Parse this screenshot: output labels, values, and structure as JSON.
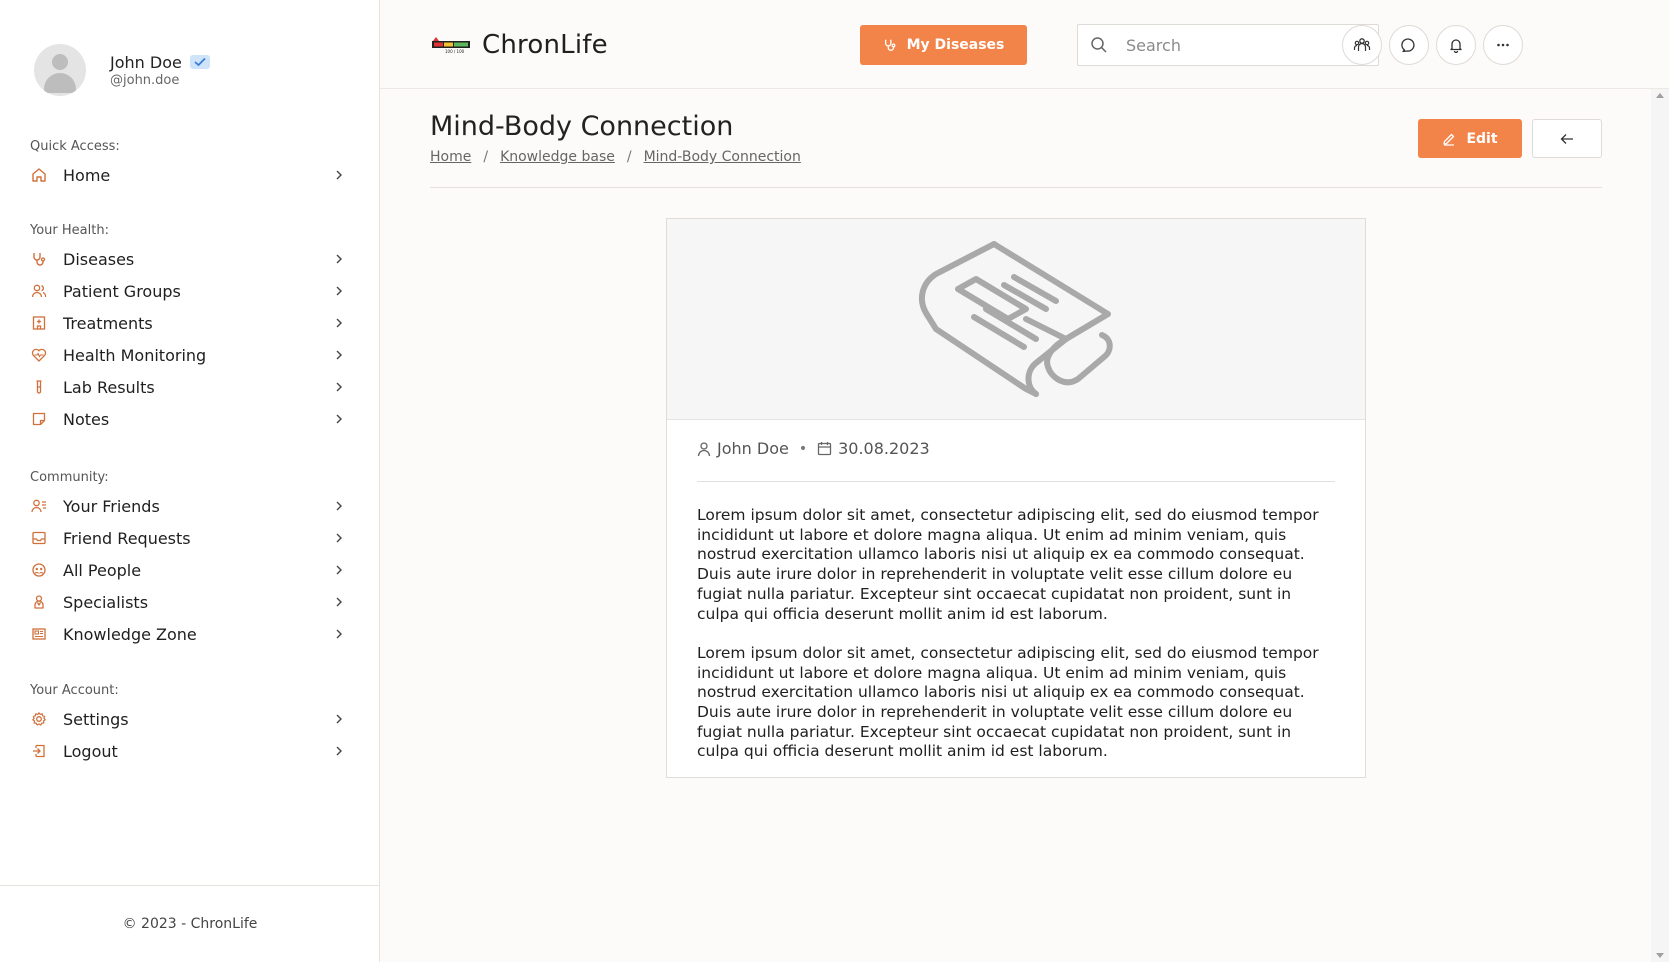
{
  "user": {
    "name": "John Doe",
    "handle": "@john.doe"
  },
  "sidebar": {
    "sections": [
      {
        "title": "Quick Access:",
        "items": [
          {
            "label": "Home",
            "icon": "home-icon"
          }
        ]
      },
      {
        "title": "Your Health:",
        "items": [
          {
            "label": "Diseases",
            "icon": "stethoscope-icon"
          },
          {
            "label": "Patient Groups",
            "icon": "users-icon"
          },
          {
            "label": "Treatments",
            "icon": "hospital-icon"
          },
          {
            "label": "Health Monitoring",
            "icon": "heart-pulse-icon"
          },
          {
            "label": "Lab Results",
            "icon": "test-tube-icon"
          },
          {
            "label": "Notes",
            "icon": "note-icon"
          }
        ]
      },
      {
        "title": "Community:",
        "items": [
          {
            "label": "Your Friends",
            "icon": "user-list-icon"
          },
          {
            "label": "Friend Requests",
            "icon": "inbox-icon"
          },
          {
            "label": "All People",
            "icon": "globe-people-icon"
          },
          {
            "label": "Specialists",
            "icon": "specialist-icon"
          },
          {
            "label": "Knowledge Zone",
            "icon": "newspaper-icon"
          }
        ]
      },
      {
        "title": "Your Account:",
        "items": [
          {
            "label": "Settings",
            "icon": "gear-icon"
          },
          {
            "label": "Logout",
            "icon": "logout-icon"
          }
        ]
      }
    ],
    "footer": "© 2023 - ChronLife"
  },
  "header": {
    "logo_text": "ChronLife",
    "logo_badge": "100 / 100",
    "my_diseases_label": "My Diseases",
    "search_placeholder": "Search"
  },
  "page": {
    "title": "Mind-Body Connection",
    "breadcrumb": [
      "Home",
      "Knowledge base",
      "Mind-Body Connection"
    ],
    "edit_label": "Edit"
  },
  "article": {
    "author": "John Doe",
    "date": "30.08.2023",
    "paragraphs": [
      "Lorem ipsum dolor sit amet, consectetur adipiscing elit, sed do eiusmod tempor incididunt ut labore et dolore magna aliqua. Ut enim ad minim veniam, quis nostrud exercitation ullamco laboris nisi ut aliquip ex ea commodo consequat. Duis aute irure dolor in reprehenderit in voluptate velit esse cillum dolore eu fugiat nulla pariatur. Excepteur sint occaecat cupidatat non proident, sunt in culpa qui officia deserunt mollit anim id est laborum.",
      "Lorem ipsum dolor sit amet, consectetur adipiscing elit, sed do eiusmod tempor incididunt ut labore et dolore magna aliqua. Ut enim ad minim veniam, quis nostrud exercitation ullamco laboris nisi ut aliquip ex ea commodo consequat. Duis aute irure dolor in reprehenderit in voluptate velit esse cillum dolore eu fugiat nulla pariatur. Excepteur sint occaecat cupidatat non proident, sunt in culpa qui officia deserunt mollit anim id est laborum."
    ]
  },
  "colors": {
    "accent": "#f2844a",
    "icon": "#d0703a"
  }
}
